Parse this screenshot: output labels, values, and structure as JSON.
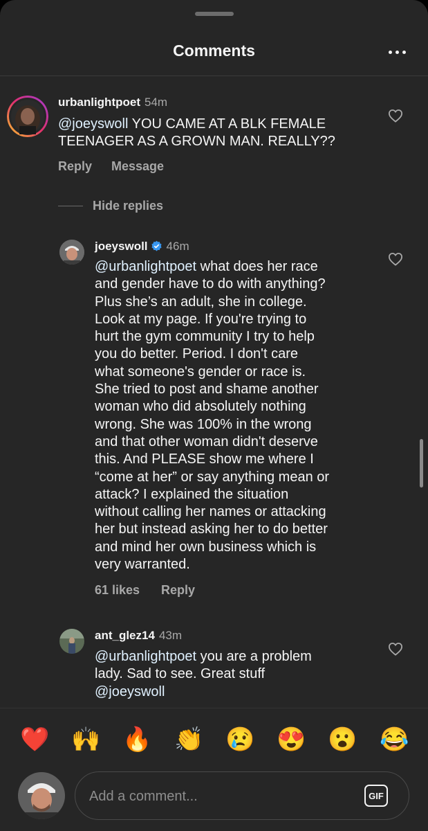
{
  "header": {
    "title": "Comments",
    "more_icon": "more-horizontal-icon"
  },
  "comments": [
    {
      "username": "urbanlightpoet",
      "time": "54m",
      "mention": "@joeyswoll",
      "text": "  YOU CAME AT A BLK FEMALE\nTEENAGER AS A GROWN MAN. REALLY??",
      "actions": [
        "Reply",
        "Message"
      ]
    }
  ],
  "hide_replies_label": "Hide replies",
  "replies": [
    {
      "username": "joeyswoll",
      "verified": true,
      "time": "46m",
      "mention": "@urbanlightpoet",
      "text": " what does her race\nand gender have to do with anything?\nPlus she’s an adult, she in college.\nLook at my page. If you're trying to\nhurt the gym community I try to help\nyou do better. Period. I don't care\nwhat someone's gender or race is.\nShe tried to post and shame another\nwoman who did absolutely nothing\nwrong. She was 100% in the wrong\nand that other woman didn't deserve\nthis. And PLEASE show me where I\n“come at her” or say anything mean or\nattack? I explained the situation\nwithout calling her names or attacking\nher but instead asking her to do better\nand mind her own business which is\nvery warranted.",
      "likes": "61 likes",
      "reply_label": "Reply"
    },
    {
      "username": "ant_glez14",
      "time": "43m",
      "mention": "@urbanlightpoet",
      "text": " you are a problem\nlady. Sad to see. Great stuff\n",
      "mention_end": "@joeyswoll"
    }
  ],
  "emoji_bar": [
    "❤️",
    "🙌",
    "🔥",
    "👏",
    "😢",
    "😍",
    "😮",
    "😂"
  ],
  "composer": {
    "placeholder": "Add a comment...",
    "gif_label": "GIF"
  }
}
